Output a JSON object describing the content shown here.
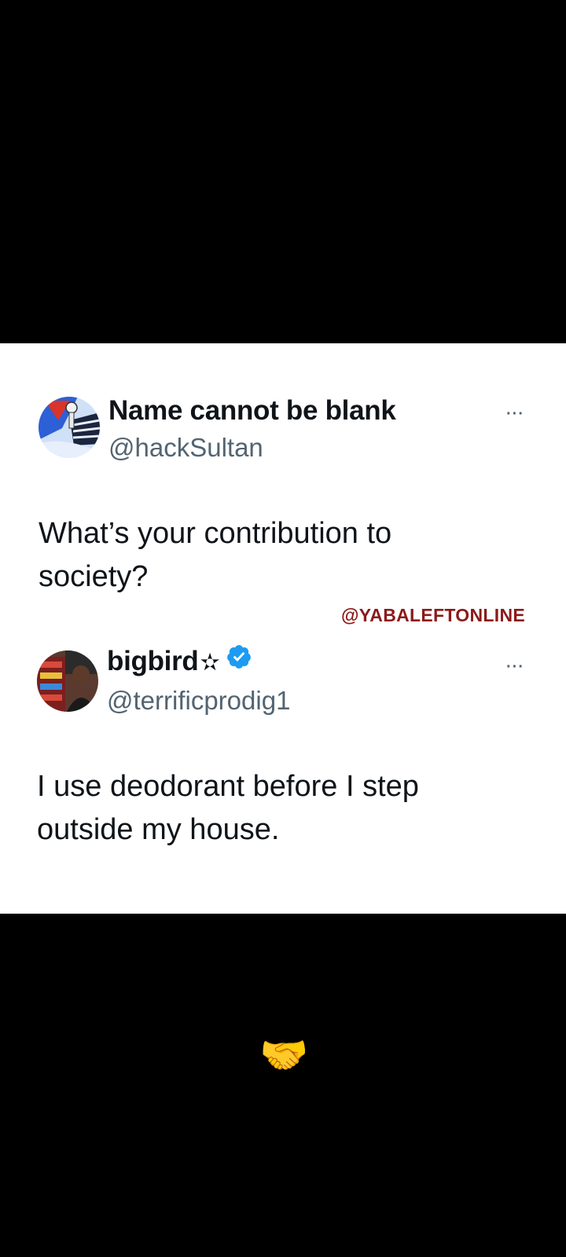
{
  "tweets": [
    {
      "display_name": "Name cannot be blank",
      "handle": "@hackSultan",
      "text_line1": "What’s your contribution to",
      "text_line2": "society?",
      "more_label": "···",
      "avatar_icon": "avatar-illustration-icon"
    },
    {
      "display_name": "bigbird",
      "name_suffix": "✫",
      "handle": "@terrificprodig1",
      "text_line1": "I use deodorant before I step",
      "text_line2": "outside my house.",
      "more_label": "···",
      "verified": true,
      "avatar_icon": "avatar-photo-icon"
    }
  ],
  "watermark": "@YABALEFTONLINE",
  "caption_emoji": "🤝",
  "colors": {
    "background": "#000000",
    "card": "#ffffff",
    "text_primary": "#0f1419",
    "text_secondary": "#536471",
    "verified_blue": "#1d9bf0",
    "watermark": "#8b1a1a"
  }
}
